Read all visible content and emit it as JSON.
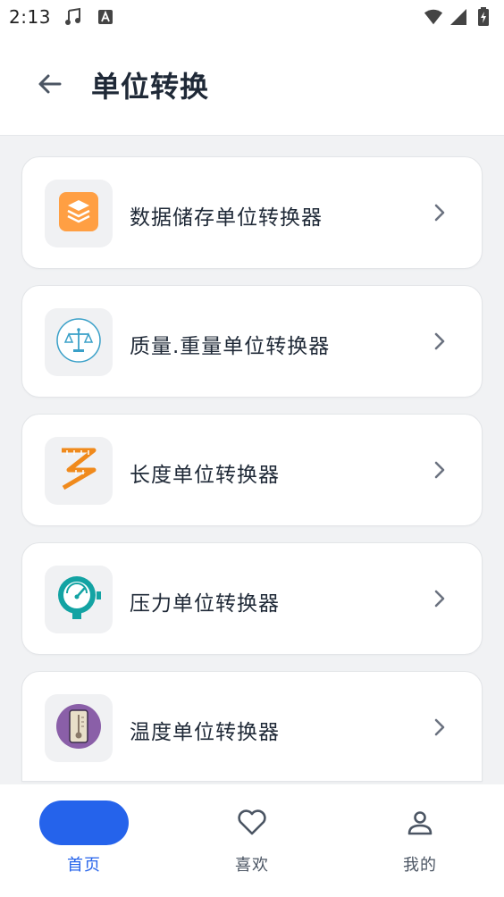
{
  "status_bar": {
    "time": "2:13",
    "icons": [
      "music-note-icon",
      "text-a-icon",
      "wifi-icon",
      "signal-icon",
      "battery-icon"
    ]
  },
  "header": {
    "title": "单位转换",
    "back_icon": "arrow-left-icon"
  },
  "converters": [
    {
      "label": "数据储存单位转换器",
      "icon": "data-storage-icon",
      "color": "#ff9f43"
    },
    {
      "label": "质量.重量单位转换器",
      "icon": "scale-balance-icon",
      "color": "#3aa0c8"
    },
    {
      "label": "长度单位转换器",
      "icon": "ruler-icon",
      "color": "#f08a1c"
    },
    {
      "label": "压力单位转换器",
      "icon": "pressure-gauge-icon",
      "color": "#13a3a3"
    },
    {
      "label": "温度单位转换器",
      "icon": "thermometer-icon",
      "color": "#8a5fa8"
    }
  ],
  "bottom_nav": {
    "items": [
      {
        "label": "首页",
        "icon": "home-icon",
        "active": true
      },
      {
        "label": "喜欢",
        "icon": "heart-icon",
        "active": false
      },
      {
        "label": "我的",
        "icon": "person-icon",
        "active": false
      }
    ]
  },
  "colors": {
    "accent": "#2563eb",
    "background": "#f1f2f4",
    "card": "#ffffff"
  }
}
